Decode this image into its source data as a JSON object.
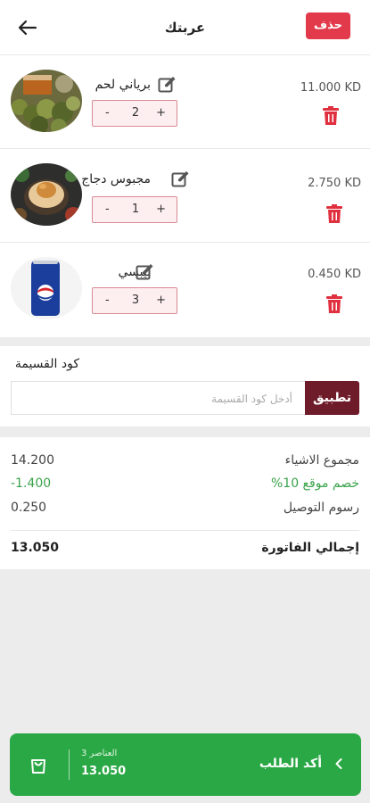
{
  "header": {
    "title": "عربتك",
    "delete_label": "حذف"
  },
  "items": [
    {
      "name": "برياني لحم",
      "quantity": "2",
      "minus": "-",
      "plus": "+",
      "price": "11.000 KD",
      "image": "biryani-dish"
    },
    {
      "name": "مجبوس دجاج",
      "quantity": "1",
      "minus": "-",
      "plus": "+",
      "price": "2.750 KD",
      "image": "machboos-dish"
    },
    {
      "name": "بيبسي",
      "quantity": "3",
      "minus": "-",
      "plus": "+",
      "price": "0.450 KD",
      "image": "pepsi-can"
    }
  ],
  "coupon": {
    "label": "كود القسيمة",
    "placeholder": "أدخل كود القسيمة",
    "apply_label": "تطبيق"
  },
  "summary": {
    "items_total_label": "مجموع الاشياء",
    "items_total_value": "14.200",
    "discount_label": "%خصم موقع 10",
    "discount_value": "-1.400",
    "delivery_label": "رسوم التوصيل",
    "delivery_value": "0.250",
    "grand_total_label": "إجمالي الفاتورة",
    "grand_total_value": "13.050"
  },
  "checkout": {
    "items_count": "العناصر 3",
    "total": "13.050",
    "confirm_label": "أكد الطلب"
  },
  "colors": {
    "accent_red": "#e23a4b",
    "apply_button": "#6f1c2a",
    "checkout_green": "#2aa845",
    "discount_green": "#3aa34a"
  },
  "icons": [
    "back-arrow-icon",
    "edit-icon",
    "trash-icon",
    "cart-icon",
    "chevron-left-icon"
  ]
}
